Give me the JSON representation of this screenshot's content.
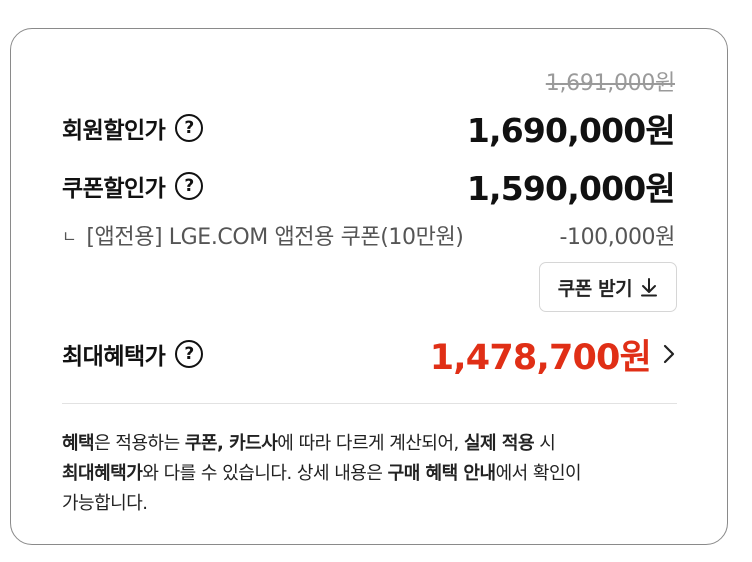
{
  "pricing": {
    "original_price": "1,691,000원",
    "member": {
      "label": "회원할인가",
      "price": "1,690,000원"
    },
    "coupon": {
      "label": "쿠폰할인가",
      "price": "1,590,000원"
    },
    "coupon_detail": {
      "marker": "ㄴ",
      "label": "[앱전용] LGE.COM 앱전용 쿠폰(10만원)",
      "amount": "-100,000원"
    },
    "coupon_button": {
      "label": "쿠폰 받기"
    },
    "max": {
      "label": "최대혜택가",
      "price": "1,478,700원"
    },
    "help_symbol": "?"
  },
  "notice": {
    "s1": "혜택",
    "s2": "은 적용하는 ",
    "s3": "쿠폰, 카드사",
    "s4": "에 따라 다르게 계산되어, ",
    "s5": "실제 적용",
    "s6": " 시",
    "s7": "최대혜택가",
    "s8": "와 다를 수 있습니다. 상세 내용은 ",
    "s9": "구매 혜택 안내",
    "s10": "에서 확인이",
    "s11": "가능합니다."
  },
  "colors": {
    "accent": "#e02f16",
    "text": "#111111",
    "muted": "#9a9a9a",
    "border": "#8a8a8a"
  },
  "icons": [
    "help-icon",
    "download-icon",
    "chevron-right-icon",
    "corner-arrow-icon"
  ]
}
